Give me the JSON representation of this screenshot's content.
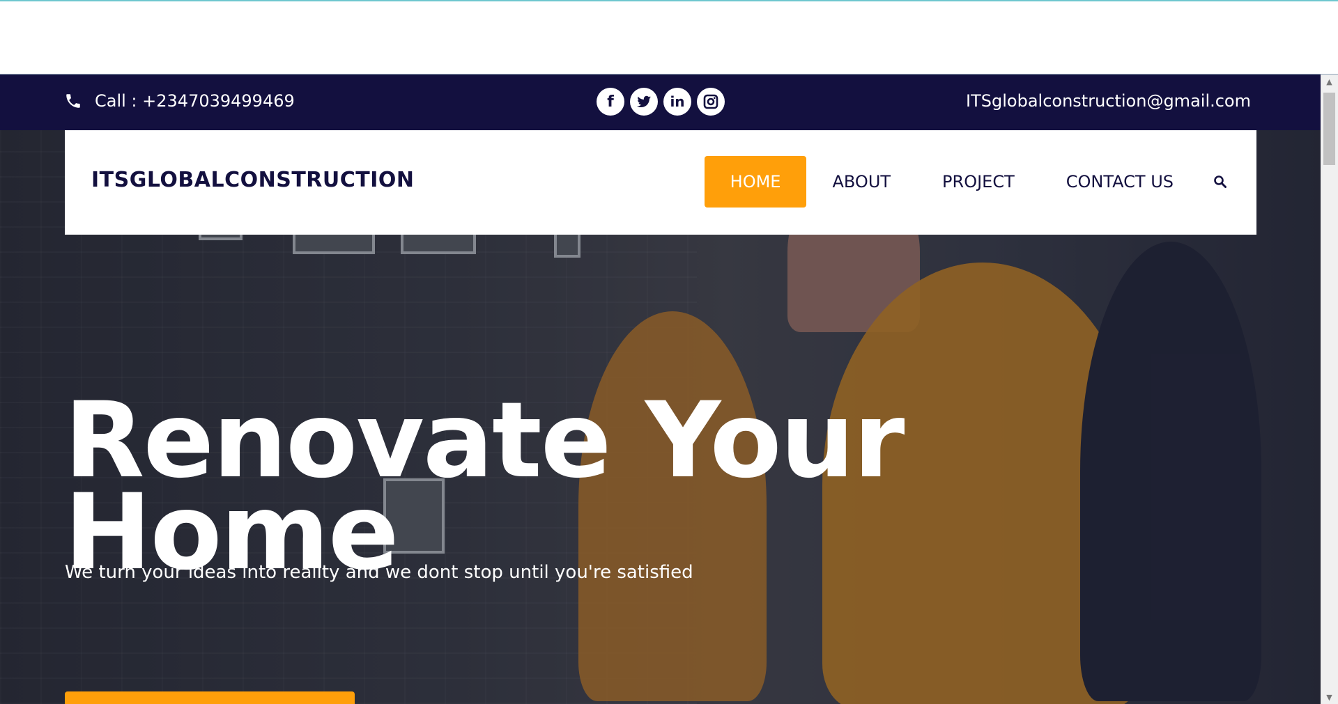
{
  "topbar": {
    "phone_text": "Call : +2347039499469",
    "email": "ITSglobalconstruction@gmail.com",
    "social": [
      {
        "icon": "facebook-icon",
        "glyph": "f"
      },
      {
        "icon": "twitter-icon",
        "glyph": "🐦"
      },
      {
        "icon": "linkedin-icon",
        "glyph": "in"
      },
      {
        "icon": "instagram-icon",
        "glyph": "◎"
      }
    ]
  },
  "nav": {
    "brand": "ITSGLOBALCONSTRUCTION",
    "items": [
      {
        "label": "HOME",
        "active": true
      },
      {
        "label": "ABOUT",
        "active": false
      },
      {
        "label": "PROJECT",
        "active": false
      },
      {
        "label": "CONTACT US",
        "active": false
      }
    ],
    "search_icon": "search-icon"
  },
  "hero": {
    "headline_line1": "Renovate Your",
    "headline_line2": "Home",
    "subtitle": "We turn your ideas into reality and we dont stop until you're satisfied"
  },
  "colors": {
    "navy": "#13103f",
    "accent": "#ff9f0a",
    "topline": "#6fc7cf"
  }
}
